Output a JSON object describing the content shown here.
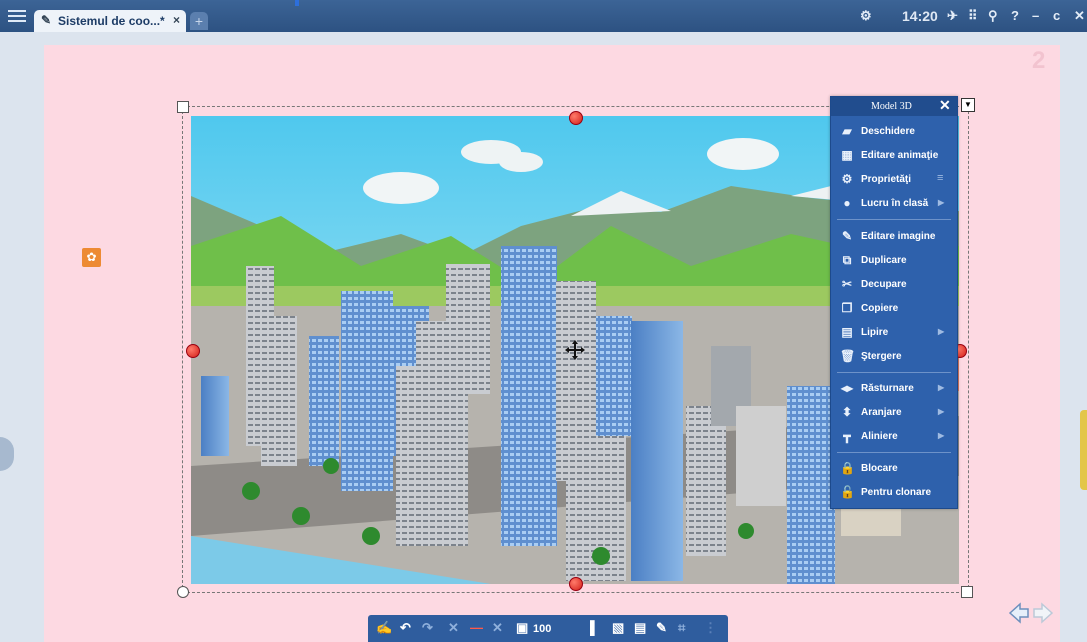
{
  "window": {
    "tab_title": "Sistemul de coo...*",
    "tab_close": "×",
    "add_tab": "+",
    "clock": "14:20",
    "buttons": {
      "help": "?",
      "minimize": "–",
      "restore": "ᴄ",
      "close": "✕"
    }
  },
  "page": {
    "number": "2"
  },
  "context_menu": {
    "title": "Model 3D",
    "close": "✕",
    "items": [
      {
        "label": "Deschidere",
        "icon": "folder-open-icon"
      },
      {
        "label": "Editare animaţie",
        "icon": "clapperboard-icon"
      },
      {
        "label": "Proprietăţi",
        "icon": "gear-icon"
      },
      {
        "label": "Lucru în clasă",
        "icon": "group-icon",
        "submenu": true
      },
      {
        "label": "Editare imagine",
        "icon": "image-edit-icon"
      },
      {
        "label": "Duplicare",
        "icon": "duplicate-icon"
      },
      {
        "label": "Decupare",
        "icon": "scissors-icon"
      },
      {
        "label": "Copiere",
        "icon": "copy-icon"
      },
      {
        "label": "Lipire",
        "icon": "paste-icon",
        "submenu": true
      },
      {
        "label": "Ştergere",
        "icon": "trash-icon"
      },
      {
        "label": "Răsturnare",
        "icon": "flip-icon",
        "submenu": true
      },
      {
        "label": "Aranjare",
        "icon": "arrange-icon",
        "submenu": true
      },
      {
        "label": "Aliniere",
        "icon": "align-icon",
        "submenu": true
      },
      {
        "label": "Blocare",
        "icon": "lock-icon"
      },
      {
        "label": "Pentru clonare",
        "icon": "clone-lock-icon"
      }
    ]
  },
  "bottom_toolbar": {
    "zoom": "100"
  },
  "colors": {
    "accent": "#2e61ac",
    "page_bg": "#fdd9e2",
    "titlebar": "#2d5282"
  }
}
